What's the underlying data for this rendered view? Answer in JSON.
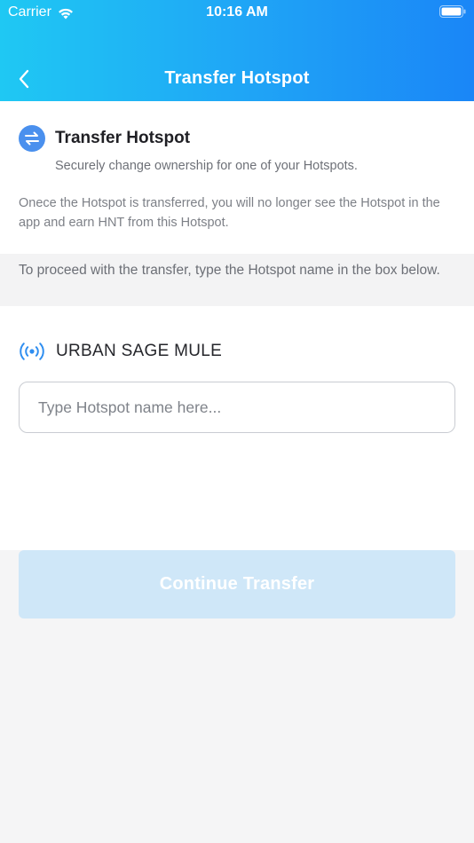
{
  "status_bar": {
    "carrier": "Carrier",
    "time": "10:16 AM",
    "wifi_icon": "wifi-icon",
    "battery_icon": "battery-icon"
  },
  "nav": {
    "title": "Transfer Hotspot",
    "back_icon": "chevron-left-icon"
  },
  "section": {
    "icon": "transfer-arrows-icon",
    "title": "Transfer Hotspot",
    "subtitle": "Securely change ownership for one of your Hotspots.",
    "warning": "Onece the Hotspot is transferred, you will no longer see the Hotspot in the app and earn HNT from this Hotspot."
  },
  "instruction": {
    "text": "To proceed with the transfer, type the Hotspot name in the box below."
  },
  "hotspot": {
    "icon": "signal-broadcast-icon",
    "name": "URBAN SAGE MULE",
    "input_value": "",
    "input_placeholder": "Type Hotspot name here..."
  },
  "actions": {
    "continue_label": "Continue Transfer",
    "continue_enabled": false
  },
  "colors": {
    "header_gradient_start": "#1fc8f3",
    "header_gradient_end": "#1a86f7",
    "accent_blue": "#4a90ee",
    "disabled_button": "#cfe7f8",
    "background": "#f5f5f6"
  }
}
